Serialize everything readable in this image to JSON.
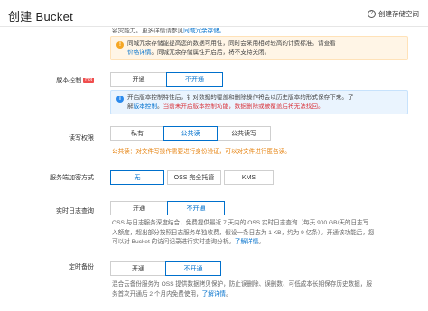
{
  "header": {
    "title": "创建 Bucket",
    "help_label": "创建存储空间"
  },
  "top_text": {
    "prefix": "容灾能力。更多详情请参见",
    "link": "同城冗余存储。"
  },
  "redundancy_alert": {
    "line1": "同城冗余存储能提高您的数据可用性，同时会采用相对较高的计费标准。请查看",
    "line2_link": "价格详情",
    "line2_rest": "。同城冗余存储属性开启后，将不支持关闭。"
  },
  "versioning": {
    "label": "版本控制",
    "hot_tag": "Hot",
    "options": [
      "开通",
      "不开通"
    ],
    "selected": "不开通",
    "alert_line1": "开启版本控制特性后，针对数据的覆盖和删除操作将会以历史版本的形式保存下来。了",
    "alert_line2_prefix": "解",
    "alert_line2_link": "版本控制",
    "alert_line2_mid": "。",
    "alert_line2_red": "当前未开启版本控制功能，数据删除或被覆盖后将无法找回。"
  },
  "acl": {
    "label": "读写权限",
    "options": [
      "私有",
      "公共读",
      "公共读写"
    ],
    "selected": "公共读",
    "warn": "公共读：对文件写操作需要进行身份验证，可以对文件进行匿名读。"
  },
  "encryption": {
    "label": "服务端加密方式",
    "options": [
      "无",
      "OSS 完全托管",
      "KMS"
    ],
    "selected": "无"
  },
  "log_query": {
    "label": "实时日志查询",
    "options": [
      "开通",
      "不开通"
    ],
    "selected": "不开通",
    "desc_line1": "OSS 与日志服务深度结合，免费提供最近 7 天内的 OSS 实时日志查询（每天 900 GB/天的日志写",
    "desc_line2": "入额度，超出部分按照日志服务单独收费，假设一条日志为 1 KB，约为 9 亿条）。开通该功能后，您",
    "desc_line3_prefix": "可以对 Bucket 的访问记录进行实时查询分析。",
    "desc_line3_link": "了解详情",
    "desc_line3_suffix": "。"
  },
  "backup": {
    "label": "定时备份",
    "options": [
      "开通",
      "不开通"
    ],
    "selected": "不开通",
    "desc_line1": "混合云备份服务为 OSS 提供数据拷贝保护，防止误删除、误删数、可低成本长期保存历史数据，服",
    "desc_line2_prefix": "务首次开通后 2 个月内免费使用，",
    "desc_line2_link": "了解详情",
    "desc_line2_suffix": "。"
  }
}
